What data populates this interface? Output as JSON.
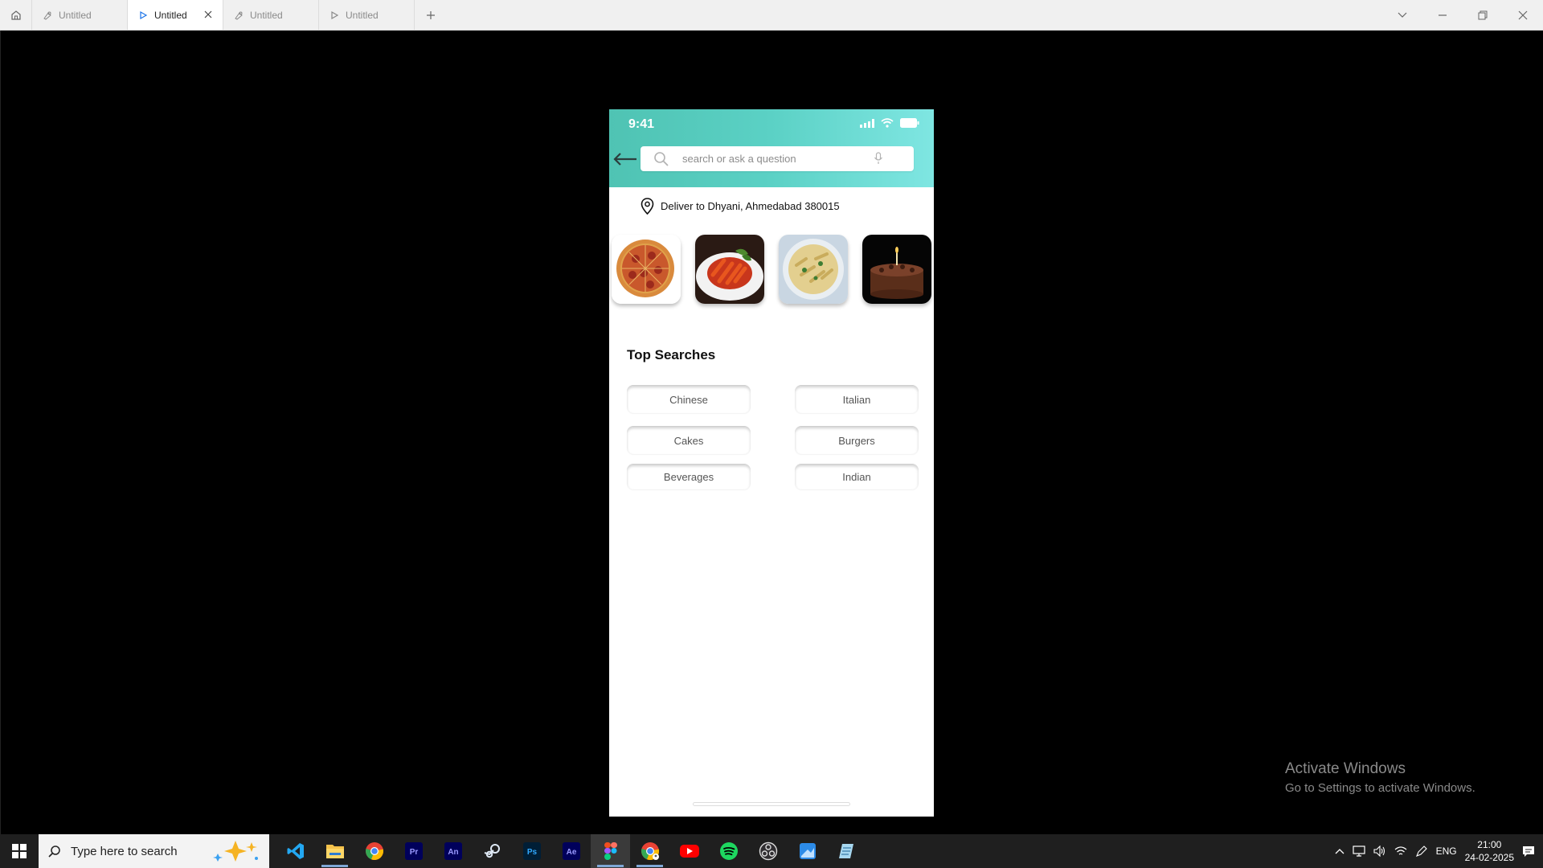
{
  "tabs": [
    {
      "label": "Untitled",
      "icon": "figma-design-icon",
      "active": false
    },
    {
      "label": "Untitled",
      "icon": "play-prototype-icon",
      "active": true
    },
    {
      "label": "Untitled",
      "icon": "figma-design-icon",
      "active": false
    },
    {
      "label": "Untitled",
      "icon": "play-prototype-icon",
      "active": false
    }
  ],
  "phone": {
    "status_time": "9:41",
    "search_placeholder": "search or ask a question",
    "deliver_text": "Deliver to Dhyani, Ahmedabad 380015",
    "foods": [
      "pizza",
      "pasta-red",
      "pasta-white",
      "chocolate-cake"
    ],
    "top_searches_title": "Top Searches",
    "chips": [
      "Chinese",
      "Italian",
      "Cakes",
      "Burgers",
      "Beverages",
      "Indian"
    ],
    "accent_gradient": [
      "#4fc3b3",
      "#7fe6e2"
    ]
  },
  "watermark": {
    "line1": "Activate Windows",
    "line2": "Go to Settings to activate Windows."
  },
  "taskbar": {
    "search_placeholder": "Type here to search",
    "apps": [
      "vscode-icon",
      "file-explorer-icon",
      "chrome-icon",
      "premiere-icon",
      "animate-icon",
      "steam-icon",
      "photoshop-icon",
      "after-effects-icon",
      "figma-icon",
      "chrome-profile-icon",
      "youtube-icon",
      "spotify-icon",
      "obs-icon",
      "paint-icon",
      "notepad-icon"
    ],
    "language": "ENG",
    "time": "21:00",
    "date": "24-02-2025"
  }
}
